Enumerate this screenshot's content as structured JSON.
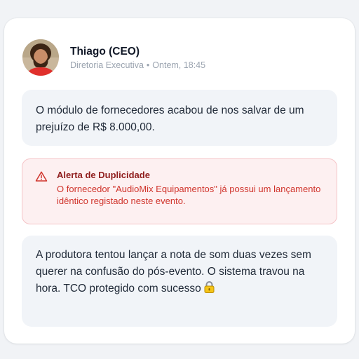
{
  "post": {
    "author_name": "Thiago (CEO)",
    "author_role": "Diretoria Executiva",
    "separator": "•",
    "timestamp": "Ontem, 18:45",
    "avatar": "person-photo-avatar"
  },
  "messages": [
    {
      "text": "O módulo de fornecedores acabou de nos salvar de um prejuízo de R$ 8.000,00."
    },
    {
      "text": "A produtora tentou lançar a nota de som duas vezes sem querer na confusão do pós-evento. O sistema travou na hora. TCO protegido com sucesso",
      "emoji": "lock-icon"
    }
  ],
  "alert": {
    "icon": "warning-triangle-icon",
    "title": "Alerta de Duplicidade",
    "body": "O fornecedor \"AudioMix Equipamentos\" já possui um lançamento idêntico registado neste evento."
  },
  "colors": {
    "alert_title": "#8f1d1d",
    "alert_text": "#d0342c",
    "alert_bg": "#fdf0f1",
    "bubble_bg": "#f1f4f8"
  }
}
